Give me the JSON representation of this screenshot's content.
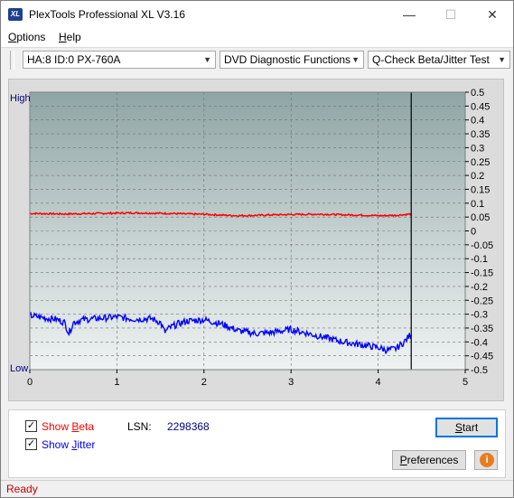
{
  "window": {
    "title": "PlexTools Professional XL V3.16",
    "icon_text": "XL",
    "minimize_glyph": "—",
    "maximize_glyph": "☐",
    "close_glyph": "✕"
  },
  "menu": {
    "options_u": "O",
    "options_rest": "ptions",
    "help_u": "H",
    "help_rest": "elp"
  },
  "toolbar": {
    "drive": "HA:8 ID:0  PX-760A",
    "function": "DVD Diagnostic Functions",
    "test": "Q-Check Beta/Jitter Test"
  },
  "chart_data": {
    "type": "line",
    "ylabel_high": "High",
    "ylabel_low": "Low",
    "x_ticks": [
      "0",
      "1",
      "2",
      "3",
      "4",
      "5"
    ],
    "xlim": [
      0,
      5
    ],
    "y_ticks": [
      "0.5",
      "0.45",
      "0.4",
      "0.35",
      "0.3",
      "0.25",
      "0.2",
      "0.15",
      "0.1",
      "0.05",
      "0",
      "-0.05",
      "-0.1",
      "-0.15",
      "-0.2",
      "-0.25",
      "-0.3",
      "-0.35",
      "-0.4",
      "-0.45",
      "-0.5"
    ],
    "ylim": [
      -0.5,
      0.5
    ],
    "grid": true,
    "end_marker_x": 4.38,
    "series": [
      {
        "color": "#ff0000",
        "x": [
          0,
          0.2,
          0.4,
          0.6,
          0.8,
          1.0,
          1.2,
          1.4,
          1.6,
          1.8,
          2.0,
          2.2,
          2.4,
          2.6,
          2.8,
          3.0,
          3.2,
          3.4,
          3.6,
          3.8,
          4.0,
          4.2,
          4.38
        ],
        "values": [
          0.063,
          0.062,
          0.061,
          0.062,
          0.063,
          0.064,
          0.065,
          0.064,
          0.063,
          0.061,
          0.06,
          0.057,
          0.055,
          0.056,
          0.058,
          0.059,
          0.06,
          0.06,
          0.058,
          0.057,
          0.055,
          0.056,
          0.061
        ]
      },
      {
        "color": "#0000ff",
        "x": [
          0,
          0.1,
          0.2,
          0.3,
          0.4,
          0.45,
          0.5,
          0.6,
          0.8,
          1.0,
          1.2,
          1.4,
          1.5,
          1.55,
          1.6,
          1.7,
          1.8,
          2.0,
          2.2,
          2.4,
          2.6,
          2.8,
          3.0,
          3.2,
          3.4,
          3.6,
          3.8,
          4.0,
          4.1,
          4.2,
          4.3,
          4.38
        ],
        "values": [
          -0.305,
          -0.31,
          -0.315,
          -0.318,
          -0.33,
          -0.37,
          -0.33,
          -0.32,
          -0.315,
          -0.31,
          -0.318,
          -0.316,
          -0.33,
          -0.365,
          -0.35,
          -0.335,
          -0.325,
          -0.32,
          -0.335,
          -0.36,
          -0.37,
          -0.365,
          -0.355,
          -0.37,
          -0.385,
          -0.4,
          -0.41,
          -0.42,
          -0.43,
          -0.425,
          -0.4,
          -0.37
        ]
      }
    ]
  },
  "bottom": {
    "show_beta_pre": "Show ",
    "show_beta_u": "B",
    "show_beta_post": "eta",
    "show_jitter_pre": "Show ",
    "show_jitter_u": "J",
    "show_jitter_post": "itter",
    "beta_checked": "✓",
    "jitter_checked": "✓",
    "lsn_label": "LSN:",
    "lsn_value": "2298368",
    "start_u": "S",
    "start_rest": "tart",
    "pref_u": "P",
    "pref_rest": "references",
    "info_glyph": "i"
  },
  "status": {
    "text": "Ready"
  },
  "colors": {
    "beta": "#ff0000",
    "jitter": "#0000ff",
    "axis_label": "#000080",
    "status": "#c00000"
  }
}
